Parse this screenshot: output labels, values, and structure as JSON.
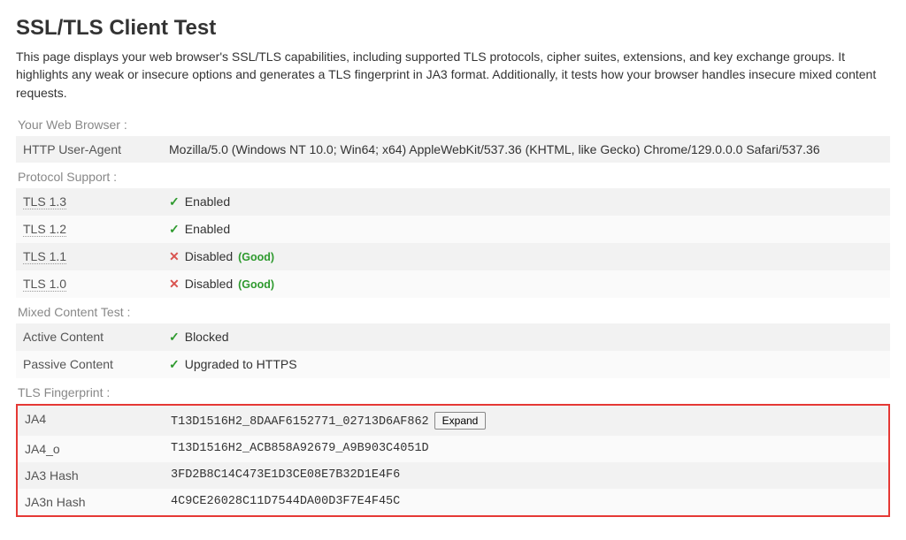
{
  "title": "SSL/TLS Client Test",
  "description": "This page displays your web browser's SSL/TLS capabilities, including supported TLS protocols, cipher suites, extensions, and key exchange groups. It highlights any weak or insecure options and generates a TLS fingerprint in JA3 format. Additionally, it tests how your browser handles insecure mixed content requests.",
  "sections": {
    "browser": {
      "label": "Your Web Browser :",
      "rows": {
        "user_agent": {
          "key": "HTTP User-Agent",
          "value": "Mozilla/5.0 (Windows NT 10.0; Win64; x64) AppleWebKit/537.36 (KHTML, like Gecko) Chrome/129.0.0.0 Safari/537.36"
        }
      }
    },
    "protocol": {
      "label": "Protocol Support :",
      "rows": {
        "tls13": {
          "key": "TLS 1.3",
          "status": "Enabled",
          "icon": "check",
          "note": ""
        },
        "tls12": {
          "key": "TLS 1.2",
          "status": "Enabled",
          "icon": "check",
          "note": ""
        },
        "tls11": {
          "key": "TLS 1.1",
          "status": "Disabled",
          "icon": "cross",
          "note": "(Good)"
        },
        "tls10": {
          "key": "TLS 1.0",
          "status": "Disabled",
          "icon": "cross",
          "note": "(Good)"
        }
      }
    },
    "mixed": {
      "label": "Mixed Content Test :",
      "rows": {
        "active": {
          "key": "Active Content",
          "status": "Blocked",
          "icon": "check"
        },
        "passive": {
          "key": "Passive Content",
          "status": "Upgraded to HTTPS",
          "icon": "check"
        }
      }
    },
    "fingerprint": {
      "label": "TLS Fingerprint :",
      "rows": {
        "ja4": {
          "key": "JA4",
          "value": "T13D1516H2_8DAAF6152771_02713D6AF862",
          "expand": "Expand"
        },
        "ja4o": {
          "key": "JA4_o",
          "value": "T13D1516H2_ACB858A92679_A9B903C4051D"
        },
        "ja3": {
          "key": "JA3 Hash",
          "value": "3FD2B8C14C473E1D3CE08E7B32D1E4F6"
        },
        "ja3n": {
          "key": "JA3n Hash",
          "value": "4C9CE26028C11D7544DA00D3F7E4F45C"
        }
      }
    }
  },
  "icons": {
    "check": "✓",
    "cross": "✕"
  }
}
